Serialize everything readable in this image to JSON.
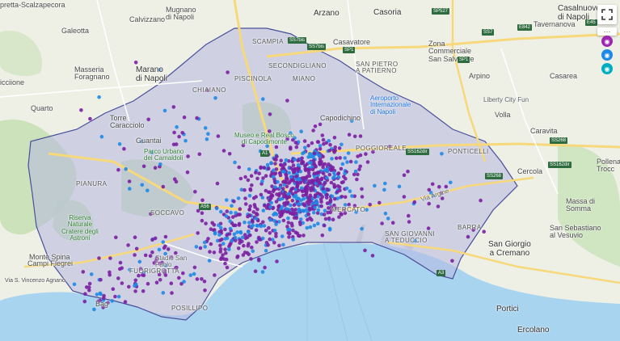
{
  "map": {
    "places": [
      {
        "id": "arzano",
        "text": "Arzano"
      },
      {
        "id": "casoria",
        "text": "Casoria"
      },
      {
        "id": "casalnuovo",
        "text": "Casalnuovo\ndi Napoli"
      },
      {
        "id": "mugnano",
        "text": "Mugnano\ndi Napoli"
      },
      {
        "id": "calvizzano",
        "text": "Calvizzano"
      },
      {
        "id": "galeotta",
        "text": "Galeotta"
      },
      {
        "id": "pretta",
        "text": "pretta-Scalzapecora"
      },
      {
        "id": "marano",
        "text": "Marano\ndi Napoli"
      },
      {
        "id": "masseria",
        "text": "Masseria\nForagnano"
      },
      {
        "id": "licciione",
        "text": "icciione"
      },
      {
        "id": "quarto",
        "text": "Quarto"
      },
      {
        "id": "torre",
        "text": "Torre\nCaracciolo"
      },
      {
        "id": "guantai",
        "text": "Guantai"
      },
      {
        "id": "casavatore",
        "text": "Casavatore"
      },
      {
        "id": "zona",
        "text": "Zona\nCommerciale\nSan Salvatore"
      },
      {
        "id": "tavernanova",
        "text": "Tavernanova"
      },
      {
        "id": "arpino",
        "text": "Arpino"
      },
      {
        "id": "casarea",
        "text": "Casarea"
      },
      {
        "id": "volla",
        "text": "Volla"
      },
      {
        "id": "caravita",
        "text": "Caravita"
      },
      {
        "id": "cercola",
        "text": "Cercola"
      },
      {
        "id": "pollena",
        "text": "Pollena\nTrocc"
      },
      {
        "id": "massa",
        "text": "Massa di\nSomma"
      },
      {
        "id": "sansebastiano",
        "text": "San Sebastiano\nal Vesuvio"
      },
      {
        "id": "sangiorgio",
        "text": "San Giorgio\na Cremano"
      },
      {
        "id": "portici",
        "text": "Portici"
      },
      {
        "id": "ercolano",
        "text": "Ercolano"
      },
      {
        "id": "campi",
        "text": "Campi Flegrei"
      },
      {
        "id": "montesanto",
        "text": "Monte Spina"
      },
      {
        "id": "via",
        "text": "Via S. Vincenzo Agnano"
      }
    ],
    "districts": [
      {
        "id": "scampia",
        "text": "SCAMPIA"
      },
      {
        "id": "secondigliano",
        "text": "SECONDIGLIANO"
      },
      {
        "id": "piscinola",
        "text": "PISCINOLA"
      },
      {
        "id": "miano",
        "text": "MIANO"
      },
      {
        "id": "chiaiano",
        "text": "CHIAIANO"
      },
      {
        "id": "sanpietro",
        "text": "SAN PIETRO\nA PATIERNO"
      },
      {
        "id": "capodichino",
        "text": "Capodichino"
      },
      {
        "id": "poggioreale",
        "text": "POGGIOREALE"
      },
      {
        "id": "ponticelli",
        "text": "PONTICELLI"
      },
      {
        "id": "pianura",
        "text": "PIANURA"
      },
      {
        "id": "soccavo",
        "text": "SOCCAVO"
      },
      {
        "id": "mercato",
        "text": "MERCATO"
      },
      {
        "id": "sangiovanni",
        "text": "SAN GIOVANNI\nA TEDUCCIO"
      },
      {
        "id": "barra",
        "text": "BARRA"
      },
      {
        "id": "fuorigrotta",
        "text": "FUORIGROTTA"
      },
      {
        "id": "posillipo",
        "text": "POSILLIPO"
      },
      {
        "id": "bagnoli",
        "text": "Bag"
      }
    ],
    "pois": [
      {
        "id": "aeroporto",
        "text": "Aeroporto\nInternazionale\ndi Napoli",
        "kind": "blue"
      },
      {
        "id": "museo",
        "text": "Museo e Real Bosco\ndi Capodimonte",
        "kind": "green"
      },
      {
        "id": "parco",
        "text": "Parco Urbano\ndei Camaldoli",
        "kind": "green"
      },
      {
        "id": "riserva",
        "text": "Riserva\nNaturale\nCratere degli\nAstroni",
        "kind": "green"
      },
      {
        "id": "liberty",
        "text": "Liberty City Fun",
        "kind": "gray"
      },
      {
        "id": "stadio",
        "text": "Stadio San\nPaolo",
        "kind": "gray"
      },
      {
        "id": "viaargine",
        "text": "Via Argine",
        "kind": "gray"
      }
    ],
    "road_shields": [
      "SS7bis",
      "SP1",
      "SP1",
      "SS7bis",
      "SS162dir",
      "SS268",
      "SS162dir",
      "A1",
      "A56",
      "A3",
      "E45",
      "E842",
      "SP527",
      "SS7",
      "SS268"
    ],
    "dot_colors": {
      "purple": "#7b1fa2",
      "blue": "#1e88e5"
    },
    "colors": {
      "land": "#eef0e6",
      "water": "#a8d4f0",
      "city_overlay": "#b7b8e0",
      "park": "#c3dfb0",
      "road_major": "#f7d87a",
      "road_minor": "#ffffff",
      "boundary": "#4a4f9a"
    }
  },
  "controls": {
    "fullscreen_icon": "fullscreen-icon",
    "more_label": "···",
    "layers": [
      {
        "name": "layer-purple",
        "color": "#9c27b0",
        "glyph": "◉"
      },
      {
        "name": "layer-blue",
        "color": "#1e88e5",
        "glyph": "◉"
      },
      {
        "name": "layer-teal",
        "color": "#00acc1",
        "glyph": "◉"
      }
    ]
  }
}
